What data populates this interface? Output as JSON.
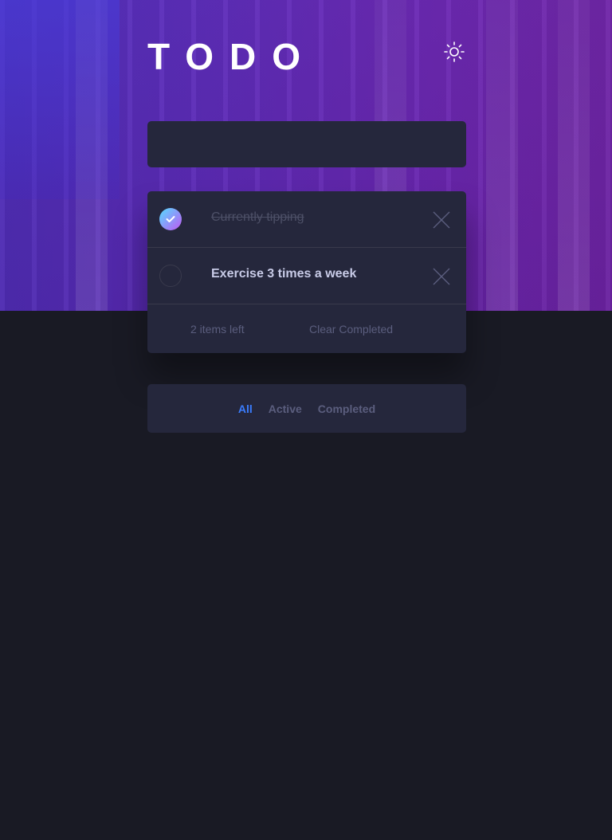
{
  "app": {
    "title": "TODO"
  },
  "header": {
    "theme_icon": "sun-icon"
  },
  "new_todo": {
    "value": "",
    "placeholder": ""
  },
  "todos": [
    {
      "text": "Currently tipping",
      "completed": true
    },
    {
      "text": "Exercise 3 times a week",
      "completed": false
    }
  ],
  "footer": {
    "items_left": "2 items left",
    "clear_label": "Clear Completed"
  },
  "filters": {
    "all": "All",
    "active": "Active",
    "completed": "Completed",
    "selected": "All"
  },
  "colors": {
    "background": "#191a24",
    "card": "#25273c",
    "accent": "#3a7cfd",
    "check_gradient_start": "#55ddff",
    "check_gradient_end": "#c058f3"
  }
}
